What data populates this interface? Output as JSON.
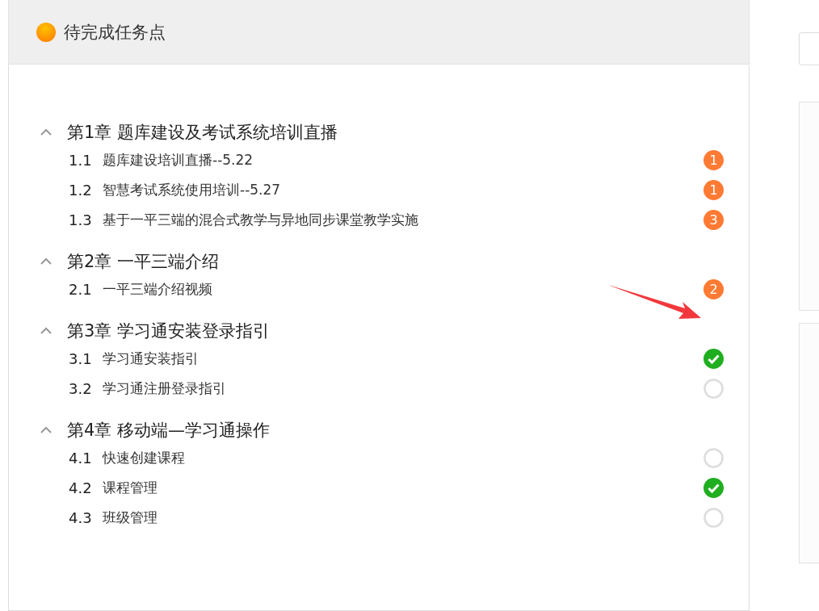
{
  "panel": {
    "title": "待完成任务点"
  },
  "chapters": [
    {
      "title": "第1章 题库建设及考试系统培训直播",
      "expanded": true,
      "items": [
        {
          "number": "1.1",
          "title": "题库建设培训直播--5.22",
          "kind": "count",
          "count": "1"
        },
        {
          "number": "1.2",
          "title": "智慧考试系统使用培训--5.27",
          "kind": "count",
          "count": "1"
        },
        {
          "number": "1.3",
          "title": "基于一平三端的混合式教学与异地同步课堂教学实施",
          "kind": "count",
          "count": "3"
        }
      ]
    },
    {
      "title": "第2章 一平三端介绍",
      "expanded": true,
      "items": [
        {
          "number": "2.1",
          "title": "一平三端介绍视频",
          "kind": "count",
          "count": "2"
        }
      ]
    },
    {
      "title": "第3章 学习通安装登录指引",
      "expanded": true,
      "items": [
        {
          "number": "3.1",
          "title": "学习通安装指引",
          "kind": "check",
          "checked": true
        },
        {
          "number": "3.2",
          "title": "学习通注册登录指引",
          "kind": "check",
          "checked": false
        }
      ]
    },
    {
      "title": "第4章 移动端—学习通操作",
      "expanded": true,
      "items": [
        {
          "number": "4.1",
          "title": "快速创建课程",
          "kind": "check",
          "checked": false
        },
        {
          "number": "4.2",
          "title": "课程管理",
          "kind": "check",
          "checked": true
        },
        {
          "number": "4.3",
          "title": "班级管理",
          "kind": "check",
          "checked": false
        }
      ]
    }
  ]
}
